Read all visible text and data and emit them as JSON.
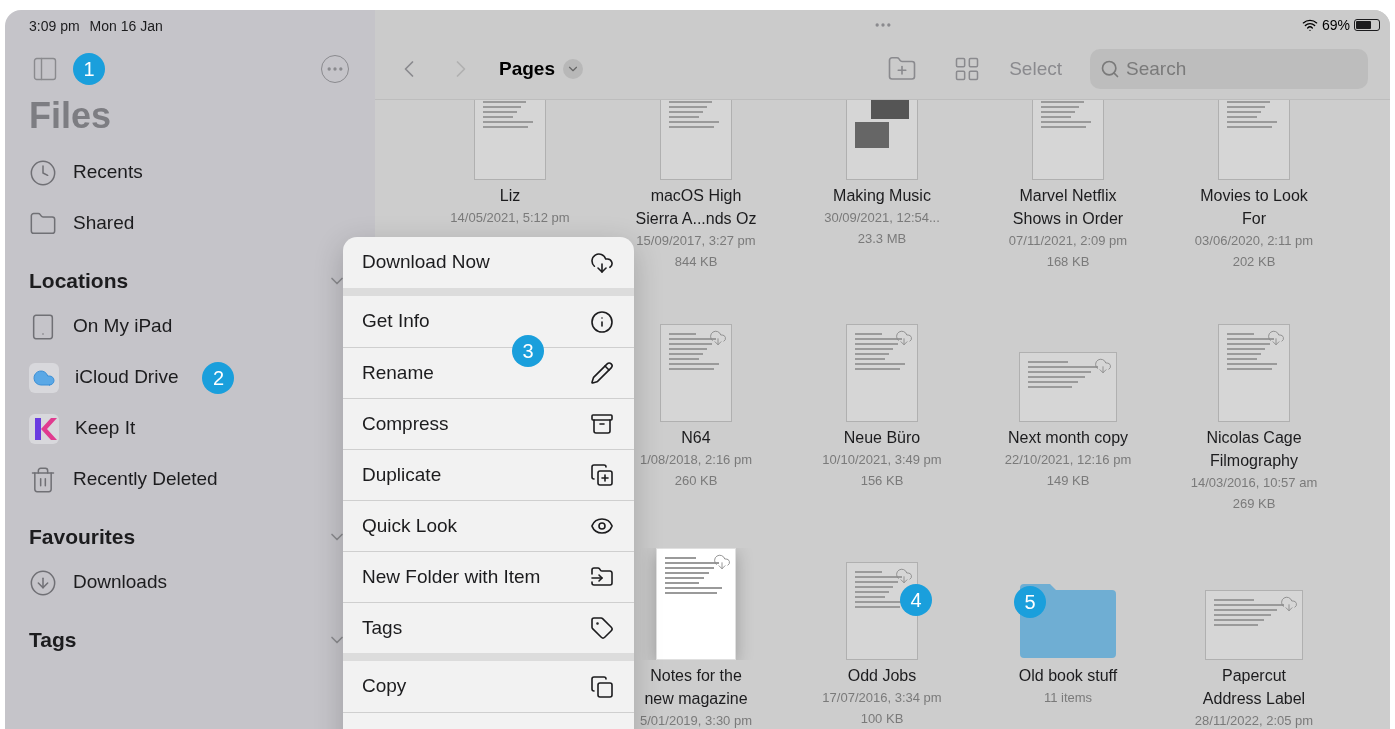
{
  "status_bar": {
    "time": "3:09 pm",
    "date": "Mon 16 Jan",
    "battery": "69%"
  },
  "sidebar": {
    "callout": "1",
    "title": "Files",
    "items": [
      {
        "label": "Recents",
        "kind": "clock"
      },
      {
        "label": "Shared",
        "kind": "shared-folder"
      }
    ],
    "sections": [
      {
        "title": "Locations",
        "expanded": true,
        "items": [
          {
            "label": "On My iPad",
            "kind": "ipad"
          },
          {
            "label": "iCloud Drive",
            "kind": "cloud",
            "callout": "2"
          },
          {
            "label": "Keep It",
            "kind": "keepit"
          },
          {
            "label": "Recently Deleted",
            "kind": "trash"
          }
        ]
      },
      {
        "title": "Favourites",
        "expanded": true,
        "items": [
          {
            "label": "Downloads",
            "kind": "download"
          }
        ]
      },
      {
        "title": "Tags",
        "expanded": true
      }
    ]
  },
  "toolbar": {
    "title": "Pages",
    "action": "Select",
    "search_placeholder": "Search"
  },
  "files": [
    [
      {
        "name": [
          "Liz"
        ],
        "meta": [
          "14/05/2021, 5:12 pm"
        ],
        "kind": "document",
        "cloud": false,
        "selected": false
      },
      {
        "name": [
          "macOS High",
          "Sierra A...nds Oz"
        ],
        "meta": [
          "15/09/2017, 3:27 pm",
          "844 KB"
        ],
        "kind": "document",
        "cloud": false,
        "selected": false
      },
      {
        "name": [
          "Making Music"
        ],
        "meta": [
          "30/09/2021, 12:54...",
          "23.3 MB"
        ],
        "kind": "photos",
        "cloud": false,
        "selected": false
      },
      {
        "name": [
          "Marvel Netflix",
          "Shows in Order"
        ],
        "meta": [
          "07/11/2021, 2:09 pm",
          "168 KB"
        ],
        "kind": "document",
        "cloud": false,
        "selected": false
      },
      {
        "name": [
          "Movies to Look",
          "For"
        ],
        "meta": [
          "03/06/2020, 2:11 pm",
          "202 KB"
        ],
        "kind": "document",
        "cloud": false,
        "selected": false
      }
    ],
    [
      {
        "name": [
          "N64"
        ],
        "meta": [
          "1/08/2018, 2:16 pm",
          "260 KB"
        ],
        "kind": "document",
        "cloud": true,
        "selected": false
      },
      {
        "name": [
          "Neue Büro"
        ],
        "meta": [
          "10/10/2021, 3:49 pm",
          "156 KB"
        ],
        "kind": "document",
        "cloud": true,
        "selected": false
      },
      {
        "name": [
          "Next month copy"
        ],
        "meta": [
          "22/10/2021, 12:16 pm",
          "149 KB"
        ],
        "kind": "landscape",
        "cloud": true,
        "selected": false
      },
      {
        "name": [
          "Nicolas Cage",
          "Filmography"
        ],
        "meta": [
          "14/03/2016, 10:57 am",
          "269 KB"
        ],
        "kind": "document",
        "cloud": true,
        "selected": false
      }
    ],
    [
      {
        "name": [
          "Notes for the",
          "new magazine"
        ],
        "meta": [
          "5/01/2019, 3:30 pm"
        ],
        "kind": "document",
        "cloud": true,
        "selected": true
      },
      {
        "name": [
          "Odd Jobs"
        ],
        "meta": [
          "17/07/2016, 3:34 pm",
          "100 KB"
        ],
        "kind": "document",
        "cloud": true,
        "selected": false,
        "callout": "4"
      },
      {
        "name": [
          "Old book stuff"
        ],
        "meta": [
          "11 items"
        ],
        "kind": "folder",
        "selected": false,
        "callout": "5"
      },
      {
        "name": [
          "Papercut",
          "Address Label"
        ],
        "meta": [
          "28/11/2022, 2:05 pm"
        ],
        "kind": "landscape",
        "cloud": true,
        "selected": false
      }
    ]
  ],
  "menu": {
    "callout": "3",
    "groups": [
      [
        {
          "label": "Download Now",
          "kind": "download-cloud"
        }
      ],
      [
        {
          "label": "Get Info",
          "kind": "info"
        },
        {
          "label": "Rename",
          "kind": "pencil"
        },
        {
          "label": "Compress",
          "kind": "archive"
        },
        {
          "label": "Duplicate",
          "kind": "duplicate"
        },
        {
          "label": "Quick Look",
          "kind": "eye"
        },
        {
          "label": "New Folder with Item",
          "kind": "new-folder"
        },
        {
          "label": "Tags",
          "kind": "tag"
        }
      ],
      [
        {
          "label": "Copy",
          "kind": "copy"
        }
      ]
    ]
  }
}
